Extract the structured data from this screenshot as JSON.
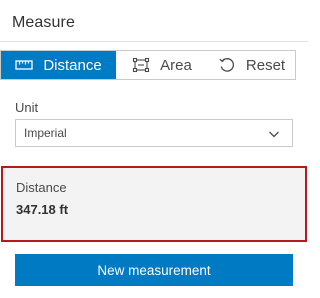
{
  "panel": {
    "title": "Measure"
  },
  "modes": [
    {
      "label": "Distance",
      "icon": "ruler-icon",
      "active": true
    },
    {
      "label": "Area",
      "icon": "area-icon",
      "active": false
    },
    {
      "label": "Reset",
      "icon": "reset-icon",
      "active": false
    }
  ],
  "unit": {
    "label": "Unit",
    "selected": "Imperial"
  },
  "result": {
    "label": "Distance",
    "value": "347.18 ft"
  },
  "actions": {
    "new_measurement": "New measurement"
  },
  "colors": {
    "accent": "#007ac2",
    "highlight_border": "#b61b1b",
    "result_bg": "#f3f3f3"
  }
}
